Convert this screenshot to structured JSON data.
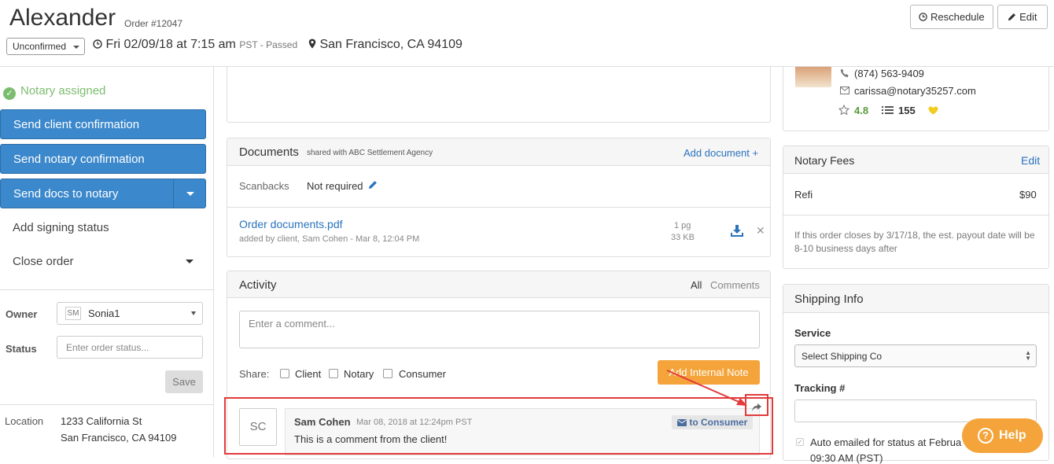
{
  "header": {
    "title": "Alexander",
    "order_number": "Order #12047",
    "status_dropdown": "Unconfirmed",
    "datetime": "Fri 02/09/18 at 7:15 am",
    "timezone_status": "PST - Passed",
    "location": "San Francisco, CA 94109",
    "reschedule_label": "Reschedule",
    "edit_label": "Edit"
  },
  "left": {
    "notary_assigned": "Notary assigned",
    "send_client": "Send client confirmation",
    "send_notary": "Send notary confirmation",
    "send_docs": "Send docs to notary",
    "add_signing_status": "Add signing status",
    "close_order": "Close order",
    "owner_label": "Owner",
    "owner_initials": "SM",
    "owner_value": "Sonia1",
    "status_label": "Status",
    "status_placeholder": "Enter order status...",
    "save_label": "Save",
    "location_label": "Location",
    "location_line1": "1233 California St",
    "location_line2": "San Francisco, CA 94109"
  },
  "documents": {
    "title": "Documents",
    "shared_with": "shared with ABC Settlement Agency",
    "add_document": "Add document +",
    "scanbacks_label": "Scanbacks",
    "scanbacks_value": "Not required",
    "file_name": "Order documents.pdf",
    "file_meta": "added by client, Sam Cohen - Mar 8, 12:04 PM",
    "file_pages": "1 pg",
    "file_size": "33 KB"
  },
  "activity": {
    "title": "Activity",
    "filter_all": "All",
    "filter_comments": "Comments",
    "comment_placeholder": "Enter a comment...",
    "share_label": "Share:",
    "share_client": "Client",
    "share_notary": "Notary",
    "share_consumer": "Consumer",
    "add_note": "Add Internal Note",
    "comment": {
      "initials": "SC",
      "author": "Sam Cohen",
      "timestamp": "Mar 08, 2018 at 12:24pm PST",
      "recipient": "to Consumer",
      "text": "This is a comment from the client!"
    }
  },
  "notary": {
    "phone": "(874) 563-9409",
    "email": "carissa@notary35257.com",
    "rating": "4.8",
    "jobs": "155"
  },
  "fees": {
    "title": "Notary Fees",
    "edit": "Edit",
    "item": "Refi",
    "amount": "$90",
    "note": "If this order closes by 3/17/18, the est. payout date will be 8-10 business days after"
  },
  "shipping": {
    "title": "Shipping Info",
    "service_label": "Service",
    "service_value": "Select Shipping Co",
    "tracking_label": "Tracking #",
    "auto_email": "Auto emailed for status at Februa",
    "auto_email_line2": "09:30 AM (PST)"
  },
  "help": {
    "label": "Help"
  },
  "colors": {
    "primary_blue": "#3b88cc",
    "success_green": "#7bbd6f",
    "accent_orange": "#f4a43a",
    "highlight_red": "#e23b3b"
  }
}
